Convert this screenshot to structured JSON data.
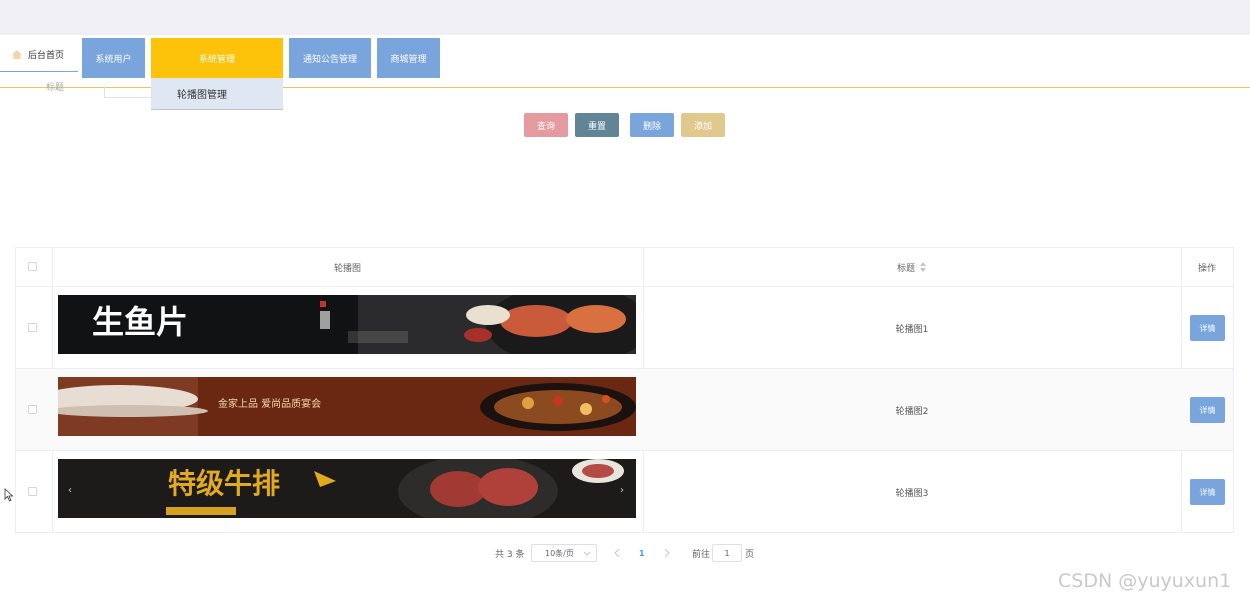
{
  "nav": {
    "home": "后台首页",
    "tabs": [
      "系统用户",
      "系统管理",
      "通知公告管理",
      "商城管理"
    ],
    "submenu_item": "轮播图管理"
  },
  "search": {
    "label": "标题"
  },
  "actions": {
    "query": "查询",
    "reset": "重置",
    "delete": "删除",
    "add": "添加"
  },
  "table": {
    "headers": {
      "image": "轮播图",
      "title": "标题",
      "ops": "操作"
    },
    "rows": [
      {
        "title": "轮播图1",
        "detail": "详情",
        "banner_text": "生鱼片"
      },
      {
        "title": "轮播图2",
        "detail": "详情",
        "banner_text": "金家上品 爱尚品质宴会"
      },
      {
        "title": "轮播图3",
        "detail": "详情",
        "banner_text": "特级牛排"
      }
    ]
  },
  "pagination": {
    "total": "共 3 条",
    "page_size": "10条/页",
    "current": "1",
    "goto_label": "前往",
    "goto_value": "1",
    "page_suffix": "页"
  },
  "watermark": "CSDN @yuyuxun1",
  "colors": {
    "nav_blue": "#7aa5dc",
    "nav_active": "#fcc30a",
    "query": "#e39ba0",
    "reset": "#618596",
    "delete": "#7aa5dc",
    "add": "#e0c98d"
  }
}
